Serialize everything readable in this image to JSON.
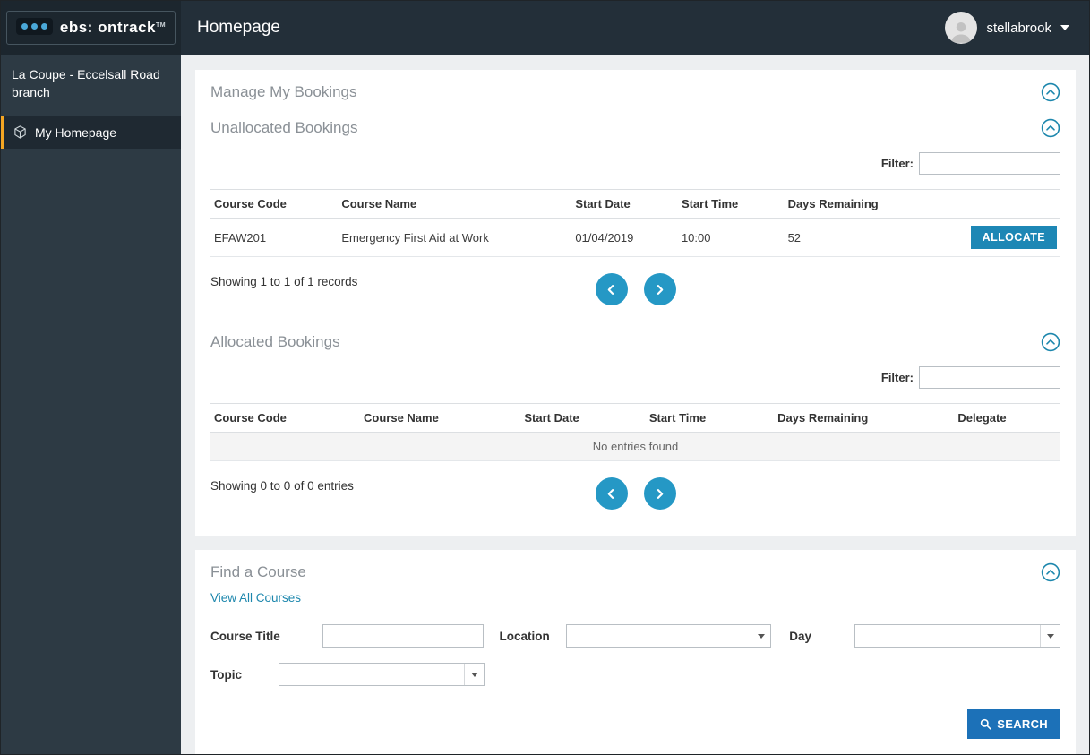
{
  "colors": {
    "accent_teal": "#1d87ad",
    "allocate_button": "#1d87b5",
    "pagination_blue": "#2598c5",
    "search_blue": "#1c71b8",
    "active_orange": "#f5a623",
    "header_dark": "#232f39",
    "sidebar_dark": "#2d3a44"
  },
  "header": {
    "logo": "ebs: ontrack",
    "logo_tm": "TM",
    "title": "Homepage",
    "user": "stellabrook"
  },
  "sidebar": {
    "branch": "La Coupe - Eccelsall Road branch",
    "items": [
      {
        "label": "My Homepage"
      }
    ]
  },
  "manage": {
    "title": "Manage My Bookings",
    "unallocated": {
      "title": "Unallocated Bookings",
      "filter_label": "Filter:",
      "columns": [
        "Course Code",
        "Course Name",
        "Start Date",
        "Start Time",
        "Days Remaining"
      ],
      "rows": [
        {
          "course_code": "EFAW201",
          "course_name": "Emergency First Aid at Work",
          "start_date": "01/04/2019",
          "start_time": "10:00",
          "days_remaining": "52",
          "action": "ALLOCATE"
        }
      ],
      "summary": "Showing 1 to 1 of 1 records"
    },
    "allocated": {
      "title": "Allocated Bookings",
      "filter_label": "Filter:",
      "columns": [
        "Course Code",
        "Course Name",
        "Start Date",
        "Start Time",
        "Days Remaining",
        "Delegate"
      ],
      "empty_text": "No entries found",
      "summary": "Showing 0 to 0 of 0 entries"
    }
  },
  "find_course": {
    "title": "Find a Course",
    "view_all": "View All Courses",
    "labels": {
      "course_title": "Course Title",
      "location": "Location",
      "day": "Day",
      "topic": "Topic"
    },
    "search": "SEARCH"
  }
}
